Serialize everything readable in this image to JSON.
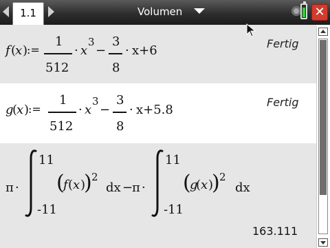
{
  "header": {
    "tab_label": "1.1",
    "document_title": "Volumen",
    "battery_level": 0.8
  },
  "entries": [
    {
      "func_name": "f",
      "var": "x",
      "assign": ":=",
      "num1": "1",
      "den1": "512",
      "dot": "·",
      "x_term": "x",
      "exp3": "3",
      "minus": "−",
      "num2": "3",
      "den2": "8",
      "tail": "x+6",
      "result": "Fertig"
    },
    {
      "func_name": "g",
      "var": "x",
      "assign": ":=",
      "num1": "1",
      "den1": "512",
      "dot": "·",
      "x_term": "x",
      "exp3": "3",
      "minus": "−",
      "num2": "3",
      "den2": "8",
      "tail": "x+5.8",
      "result": "Fertig"
    }
  ],
  "integral_entry": {
    "pi": "π",
    "dot": "·",
    "upper": "11",
    "lower": "-11",
    "f_func": "f",
    "g_func": "g",
    "var": "x",
    "exp": "2",
    "dx": "dx",
    "minus": "−",
    "result": "163.111"
  },
  "icons": {
    "left_arrow": "left-arrow-icon",
    "right_arrow": "right-arrow-icon",
    "dropdown": "chevron-down-icon",
    "settings": "gear-icon",
    "battery": "battery-icon",
    "close": "close-icon"
  },
  "colors": {
    "close_red": "#d23b2e",
    "battery_green": "#2fd13a",
    "entry_gray": "#e6e6e6"
  }
}
